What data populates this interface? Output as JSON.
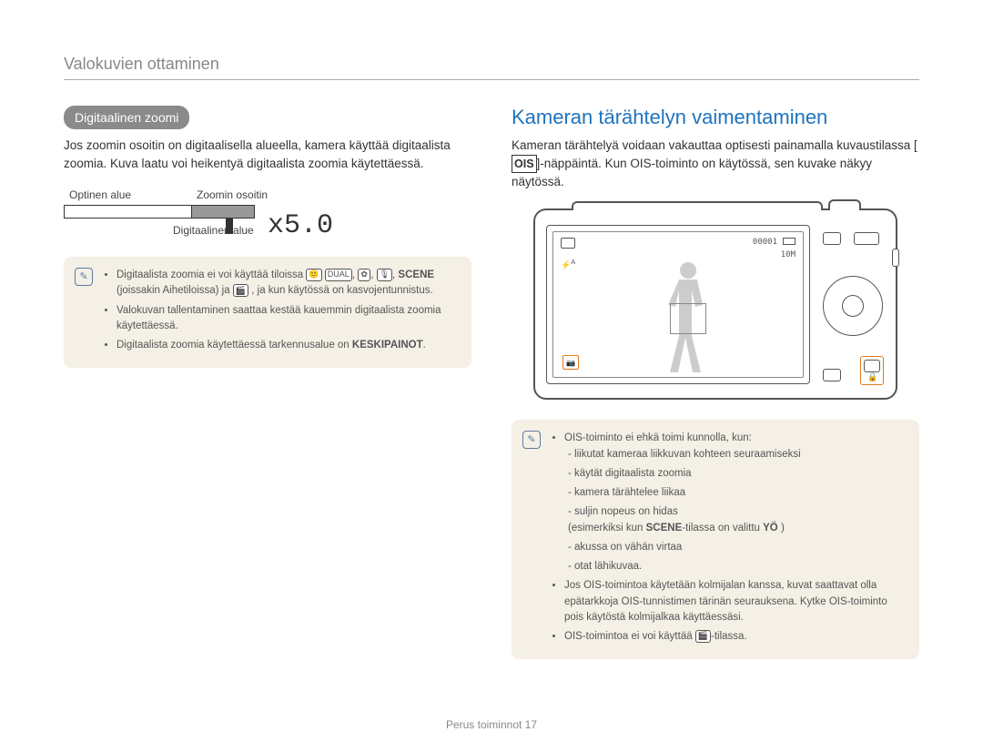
{
  "header": {
    "title": "Valokuvien ottaminen"
  },
  "left": {
    "pill": "Digitaalinen zoomi",
    "intro": "Jos zoomin osoitin on digitaalisella alueella, kamera käyttää digitaalista zoomia. Kuva laatu voi heikentyä digitaalista zoomia käytettäessä.",
    "zoom": {
      "optical_label": "Optinen alue",
      "pointer_label": "Zoomin osoitin",
      "digital_label": "Digitaalinen alue",
      "value": "x5.0"
    },
    "note": {
      "bullets": [
        {
          "pre": "Digitaalista zoomia ei voi käyttää tiloissa ",
          "glyphs": [
            "🙂",
            "DUAL",
            "✿",
            "🎙"
          ],
          "mid": ", ",
          "scene": "SCENE",
          "post1": " (joissakin Aihetiloissa) ja ",
          "glyph2": "🎬",
          "post2": ", ja kun käytössä on kasvojentunnistus."
        },
        {
          "text": "Valokuvan tallentaminen saattaa kestää kauemmin digitaalista zoomia käytettäessä."
        },
        {
          "pre": "Digitaalista zoomia käytettäessä tarkennusalue on ",
          "bold": "KESKIPAINOT",
          "post": "."
        }
      ]
    }
  },
  "right": {
    "heading": "Kameran tärähtelyn vaimentaminen",
    "intro_pre": "Kameran tärähtelyä voidaan vakauttaa optisesti painamalla kuvaustilassa [",
    "intro_key": "OIS",
    "intro_post": "]-näppäintä. Kun OIS-toiminto on käytössä, sen kuvake näkyy näytössä.",
    "screen": {
      "ois_label": "📷",
      "count": "00001",
      "res": "10M"
    },
    "note": {
      "lead": "OIS-toiminto ei ehkä toimi kunnolla, kun:",
      "subs": [
        "liikutat kameraa liikkuvan kohteen seuraamiseksi",
        "käytät digitaalista zoomia",
        "kamera tärähtelee liikaa",
        "suljin nopeus on hidas"
      ],
      "sub_example_pre": "(esimerkiksi kun ",
      "sub_example_scene": "SCENE",
      "sub_example_mid": "-tilassa on valittu ",
      "sub_example_bold": "YÖ",
      "sub_example_post": " )",
      "subs2": [
        "akussa on vähän virtaa",
        "otat lähikuvaa."
      ],
      "b2": "Jos OIS-toimintoa käytetään kolmijalan kanssa, kuvat saattavat olla epätarkkoja OIS-tunnistimen tärinän seurauksena. Kytke OIS-toiminto pois käytöstä kolmijalkaa käyttäessäsi.",
      "b3_pre": "OIS-toimintoa ei voi käyttää ",
      "b3_glyph": "🎬",
      "b3_post": "-tilassa."
    }
  },
  "footer": {
    "section": "Perus toiminnot",
    "page": "17"
  }
}
